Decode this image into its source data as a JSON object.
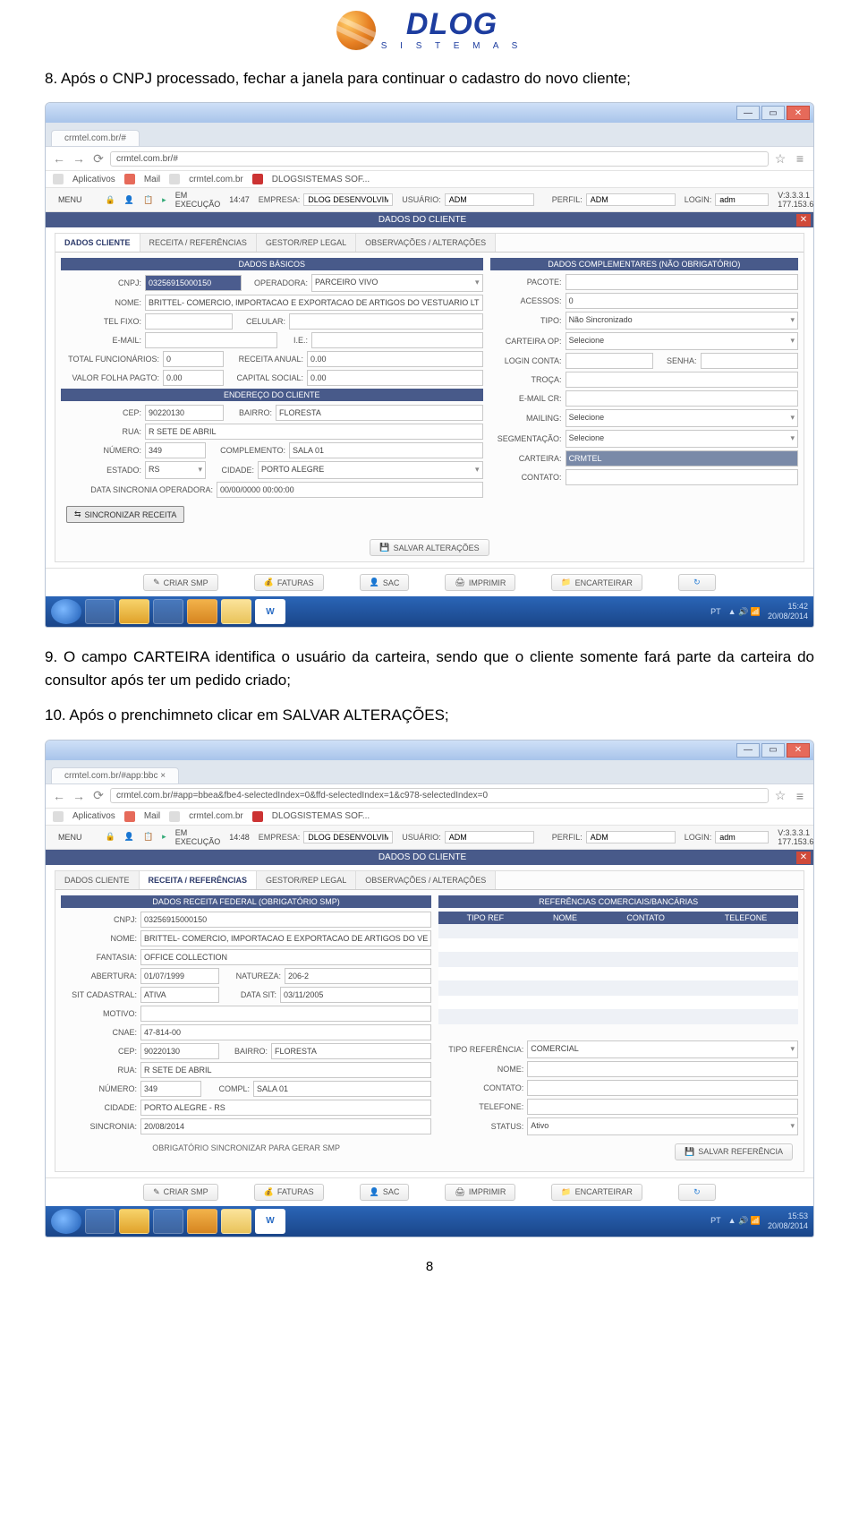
{
  "logo": {
    "main": "DLOG",
    "sub": "S I S T E M A S"
  },
  "para8": "8. Após o CNPJ processado, fechar a janela para continuar o cadastro do novo cliente;",
  "para9": "9. O campo CARTEIRA identifica o usuário da carteira, sendo que o cliente somente fará parte da carteira do consultor após ter um pedido criado;",
  "para10": "10. Após o prenchimneto clicar em SALVAR ALTERAÇÕES;",
  "page_num": "8",
  "browser1": {
    "tab": "crmtel.com.br/#",
    "url": "crmtel.com.br/#",
    "bookmarks": {
      "apps": "Aplicativos",
      "mail": "Mail",
      "crm": "crmtel.com.br",
      "dlog": "DLOGSISTEMAS SOF..."
    }
  },
  "menu1": {
    "menu": "MENU",
    "status": "EM EXECUÇÃO",
    "time": "14:47",
    "empresa_lbl": "EMPRESA:",
    "empresa_val": "DLOG DESENVOLVIM",
    "usuario_lbl": "USUÁRIO:",
    "usuario_val": "ADM",
    "perfil_lbl": "PERFIL:",
    "perfil_val": "ADM",
    "login_lbl": "LOGIN:",
    "login_val": "adm",
    "version": "V:3.3.3.1   177.153.6.234"
  },
  "panel1": {
    "title": "DADOS DO CLIENTE",
    "tabs": [
      "DADOS CLIENTE",
      "RECEITA / REFERÊNCIAS",
      "GESTOR/REP LEGAL",
      "OBSERVAÇÕES / ALTERAÇÕES"
    ],
    "left_hdr": "DADOS BÁSICOS",
    "right_hdr": "DADOS COMPLEMENTARES (NÃO OBRIGATÓRIO)",
    "addr_hdr": "ENDEREÇO DO CLIENTE",
    "left": {
      "cnpj_lbl": "CNPJ:",
      "cnpj_val": "03256915000150",
      "oper_lbl": "OPERADORA:",
      "oper_val": "PARCEIRO VIVO",
      "nome_lbl": "NOME:",
      "nome_val": "BRITTEL- COMERCIO, IMPORTACAO E EXPORTACAO DE ARTIGOS DO VESTUARIO LT",
      "tel_lbl": "TEL FIXO:",
      "cel_lbl": "CELULAR:",
      "email_lbl": "E-MAIL:",
      "ie_lbl": "I.E.:",
      "func_lbl": "TOTAL FUNCIONÁRIOS:",
      "func_val": "0",
      "rec_lbl": "RECEITA ANUAL:",
      "rec_val": "0.00",
      "folha_lbl": "VALOR FOLHA PAGTO:",
      "folha_val": "0.00",
      "cap_lbl": "CAPITAL SOCIAL:",
      "cap_val": "0.00",
      "cep_lbl": "CEP:",
      "cep_val": "90220130",
      "bairro_lbl": "BAIRRO:",
      "bairro_val": "FLORESTA",
      "rua_lbl": "RUA:",
      "rua_val": "R SETE DE ABRIL",
      "num_lbl": "NÚMERO:",
      "num_val": "349",
      "compl_lbl": "COMPLEMENTO:",
      "compl_val": "SALA 01",
      "est_lbl": "ESTADO:",
      "est_val": "RS",
      "cid_lbl": "CIDADE:",
      "cid_val": "PORTO ALEGRE",
      "sync_lbl": "DATA SINCRONIA OPERADORA:",
      "sync_val": "00/00/0000 00:00:00"
    },
    "right": {
      "pacote_lbl": "PACOTE:",
      "acessos_lbl": "ACESSOS:",
      "acessos_val": "0",
      "tipo_lbl": "TIPO:",
      "tipo_val": "Não Sincronizado",
      "cartop_lbl": "CARTEIRA OP:",
      "cartop_val": "Selecione",
      "login_lbl": "LOGIN CONTA:",
      "senha_lbl": "SENHA:",
      "troca_lbl": "TROÇA:",
      "emailcr_lbl": "E-MAIL CR:",
      "mailing_lbl": "MAILING:",
      "mailing_val": "Selecione",
      "seg_lbl": "SEGMENTAÇÃO:",
      "seg_val": "Selecione",
      "cart_lbl": "CARTEIRA:",
      "cart_val": "CRMTEL",
      "cont_lbl": "CONTATO:"
    },
    "sync_btn": "SINCRONIZAR RECEITA",
    "save_btn": "SALVAR ALTERAÇÕES"
  },
  "bottom_btns": {
    "criar": "CRIAR SMP",
    "faturas": "FATURAS",
    "sac": "SAC",
    "imprimir": "IMPRIMIR",
    "encart": "ENCARTEIRAR"
  },
  "clock1": {
    "time": "15:42",
    "date": "20/08/2014"
  },
  "browser2": {
    "tab": "crmtel.com.br/#app:bbc ×",
    "url": "crmtel.com.br/#app=bbea&fbe4-selectedIndex=0&ffd-selectedIndex=1&c978-selectedIndex=0"
  },
  "menu2": {
    "time": "14:48"
  },
  "panel2": {
    "left_hdr": "DADOS RECEITA FEDERAL (OBRIGATÓRIO SMP)",
    "right_hdr": "REFERÊNCIAS COMERCIAIS/BANCÁRIAS",
    "tbl_cols": [
      "TIPO REF",
      "NOME",
      "CONTATO",
      "TELEFONE"
    ],
    "left": {
      "cnpj_lbl": "CNPJ:",
      "cnpj_val": "03256915000150",
      "nome_lbl": "NOME:",
      "nome_val": "BRITTEL- COMERCIO, IMPORTACAO E EXPORTACAO DE ARTIGOS DO VE",
      "fant_lbl": "FANTASIA:",
      "fant_val": "OFFICE COLLECTION",
      "abert_lbl": "ABERTURA:",
      "abert_val": "01/07/1999",
      "nat_lbl": "NATUREZA:",
      "nat_val": "206-2",
      "sit_lbl": "SIT CADASTRAL:",
      "sit_val": "ATIVA",
      "dsit_lbl": "DATA SIT:",
      "dsit_val": "03/11/2005",
      "mot_lbl": "MOTIVO:",
      "cnae_lbl": "CNAE:",
      "cnae_val": "47-814-00",
      "cep_lbl": "CEP:",
      "cep_val": "90220130",
      "bairro_lbl": "BAIRRO:",
      "bairro_val": "FLORESTA",
      "rua_lbl": "RUA:",
      "rua_val": "R SETE DE ABRIL",
      "num_lbl": "NÚMERO:",
      "num_val": "349",
      "compl_lbl": "COMPL:",
      "compl_val": "SALA 01",
      "cid_lbl": "CIDADE:",
      "cid_val": "PORTO ALEGRE - RS",
      "sinc_lbl": "SINCRONIA:",
      "sinc_val": "20/08/2014"
    },
    "right": {
      "tref_lbl": "TIPO REFERÊNCIA:",
      "tref_val": "COMERCIAL",
      "nome_lbl": "NOME:",
      "cont_lbl": "CONTATO:",
      "tel_lbl": "TELEFONE:",
      "stat_lbl": "STATUS:",
      "stat_val": "Ativo"
    },
    "save_ref": "SALVAR REFERÊNCIA",
    "note": "OBRIGATÓRIO SINCRONIZAR PARA GERAR SMP"
  },
  "clock2": {
    "time": "15:53",
    "date": "20/08/2014"
  }
}
